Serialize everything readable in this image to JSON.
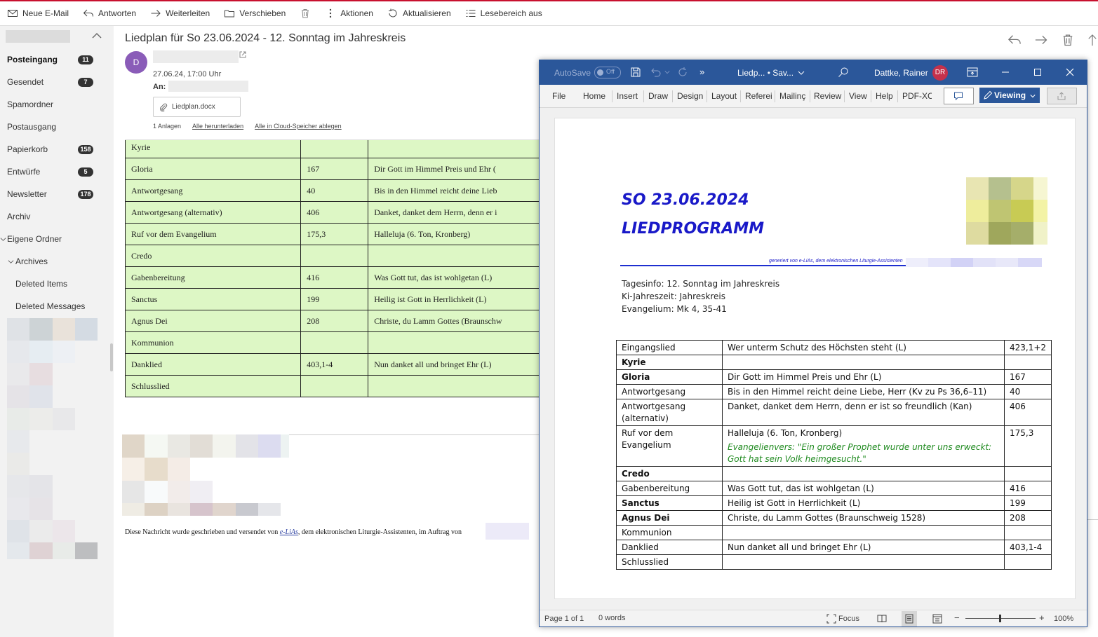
{
  "toolbar": {
    "new_mail": "Neue E-Mail",
    "reply": "Antworten",
    "forward": "Weiterleiten",
    "move": "Verschieben",
    "actions": "Aktionen",
    "refresh": "Aktualisieren",
    "reading_pane": "Lesebereich aus"
  },
  "sidebar": {
    "folders": [
      {
        "label": "Posteingang",
        "count": "11"
      },
      {
        "label": "Gesendet",
        "count": "7"
      },
      {
        "label": "Spamordner",
        "count": ""
      },
      {
        "label": "Postausgang",
        "count": ""
      },
      {
        "label": "Papierkorb",
        "count": "158"
      },
      {
        "label": "Entwürfe",
        "count": "5"
      },
      {
        "label": "Newsletter",
        "count": "178"
      },
      {
        "label": "Archiv",
        "count": ""
      }
    ],
    "own_folders": "Eigene Ordner",
    "archives": "Archives",
    "deleted_items": "Deleted Items",
    "deleted_messages": "Deleted Messages"
  },
  "mail": {
    "subject": "Liedplan für So 23.06.2024 - 12. Sonntag im Jahreskreis",
    "avatar_letter": "D",
    "date": "27.06.24, 17:00 Uhr",
    "to_label": "An:",
    "attachment_name": "Liedplan.docx",
    "attachments_count": "1 Anlagen",
    "download_all": "Alle herunterladen",
    "save_cloud": "Alle in Cloud-Speicher ablegen",
    "table_rows": [
      {
        "part": "Kyrie",
        "num": "",
        "title": ""
      },
      {
        "part": "Gloria",
        "num": "167",
        "title": "Dir Gott im Himmel Preis und Ehr ("
      },
      {
        "part": "Antwortgesang",
        "num": "40",
        "title": "Bis in den Himmel reicht deine Lieb"
      },
      {
        "part": "Antwortgesang (alternativ)",
        "num": "406",
        "title": "Danket, danket dem Herrn, denn er i"
      },
      {
        "part": "Ruf vor dem Evangelium",
        "num": "175,3",
        "title": "Halleluja (6. Ton, Kronberg)"
      },
      {
        "part": "Credo",
        "num": "",
        "title": ""
      },
      {
        "part": "Gabenbereitung",
        "num": "416",
        "title": "Was Gott tut, das ist wohlgetan (L)"
      },
      {
        "part": "Sanctus",
        "num": "199",
        "title": "Heilig ist Gott in Herrlichkeit (L)"
      },
      {
        "part": "Agnus Dei",
        "num": "208",
        "title": "Christe, du Lamm Gottes (Braunschw"
      },
      {
        "part": "Kommunion",
        "num": "",
        "title": ""
      },
      {
        "part": "Danklied",
        "num": "403,1-4",
        "title": "Nun danket all und bringet Ehr (L)"
      },
      {
        "part": "Schlusslied",
        "num": "",
        "title": ""
      }
    ],
    "footer_pre": "Diese Nachricht wurde geschrieben und versendet von ",
    "footer_link": "e-LiAs",
    "footer_post": ", dem elektronischen Liturgie-Assistenten, im Auftrag von"
  },
  "word": {
    "autosave": "AutoSave",
    "autosave_state": "Off",
    "doc_title": "Liedp... • Sav...",
    "user_name": "Dattke, Rainer",
    "user_initials": "DR",
    "tabs": [
      "File",
      "Home",
      "Insert",
      "Draw",
      "Design",
      "Layout",
      "Referei",
      "Mailinç",
      "Review",
      "View",
      "Help",
      "PDF-XC"
    ],
    "viewing": "Viewing",
    "status_page": "Page 1 of 1",
    "status_words": "0 words",
    "focus": "Focus",
    "zoom": "100%",
    "doc": {
      "date_heading": "SO 23.06.2024",
      "heading": "LIEDPROGRAMM",
      "generated": "generiert von e-LiAs, dem elektronischen Liturgie-Assistenten",
      "info1": "Tagesinfo: 12. Sonntag im Jahreskreis",
      "info2": "Ki-Jahreszeit: Jahreskreis",
      "info3": "Evangelium: Mk 4, 35-41",
      "rows": [
        {
          "part": "Eingangslied",
          "title": "Wer unterm Schutz des Höchsten steht (L)",
          "num": "423,1+2",
          "bold": false
        },
        {
          "part": "Kyrie",
          "title": "",
          "num": "",
          "bold": true
        },
        {
          "part": "Gloria",
          "title": "Dir Gott im Himmel Preis und Ehr (L)",
          "num": "167",
          "bold": true
        },
        {
          "part": "Antwortgesang",
          "title": "Bis in den Himmel reicht deine Liebe, Herr (Kv zu Ps 36,6–11)",
          "num": "40",
          "bold": false
        },
        {
          "part": "Antwortgesang (alternativ)",
          "title": "Danket, danket dem Herrn, denn er ist so freundlich (Kan)",
          "num": "406",
          "bold": false
        },
        {
          "part": "Ruf vor dem Evangelium",
          "title": "Halleluja (6. Ton, Kronberg)",
          "note": "Evangelienvers: \"Ein großer Prophet wurde unter uns erweckt: Gott hat sein Volk heimgesucht.\"",
          "num": "175,3",
          "bold": false
        },
        {
          "part": "Credo",
          "title": "",
          "num": "",
          "bold": true
        },
        {
          "part": "Gabenbereitung",
          "title": "Was Gott tut, das ist wohlgetan (L)",
          "num": "416",
          "bold": false
        },
        {
          "part": "Sanctus",
          "title": "Heilig ist Gott in Herrlichkeit (L)",
          "num": "199",
          "bold": true
        },
        {
          "part": "Agnus Dei",
          "title": "Christe, du Lamm Gottes (Braunschweig 1528)",
          "num": "208",
          "bold": true
        },
        {
          "part": "Kommunion",
          "title": "",
          "num": "",
          "bold": false
        },
        {
          "part": "Danklied",
          "title": "Nun danket all und bringet Ehr (L)",
          "num": "403,1-4",
          "bold": false
        },
        {
          "part": "Schlusslied",
          "title": "",
          "num": "",
          "bold": false
        }
      ]
    }
  },
  "colors": {
    "accent_red": "#c8102e",
    "word_blue": "#2b579a",
    "table_green": "#ddf7c5",
    "heading_blue": "#1919c8"
  }
}
